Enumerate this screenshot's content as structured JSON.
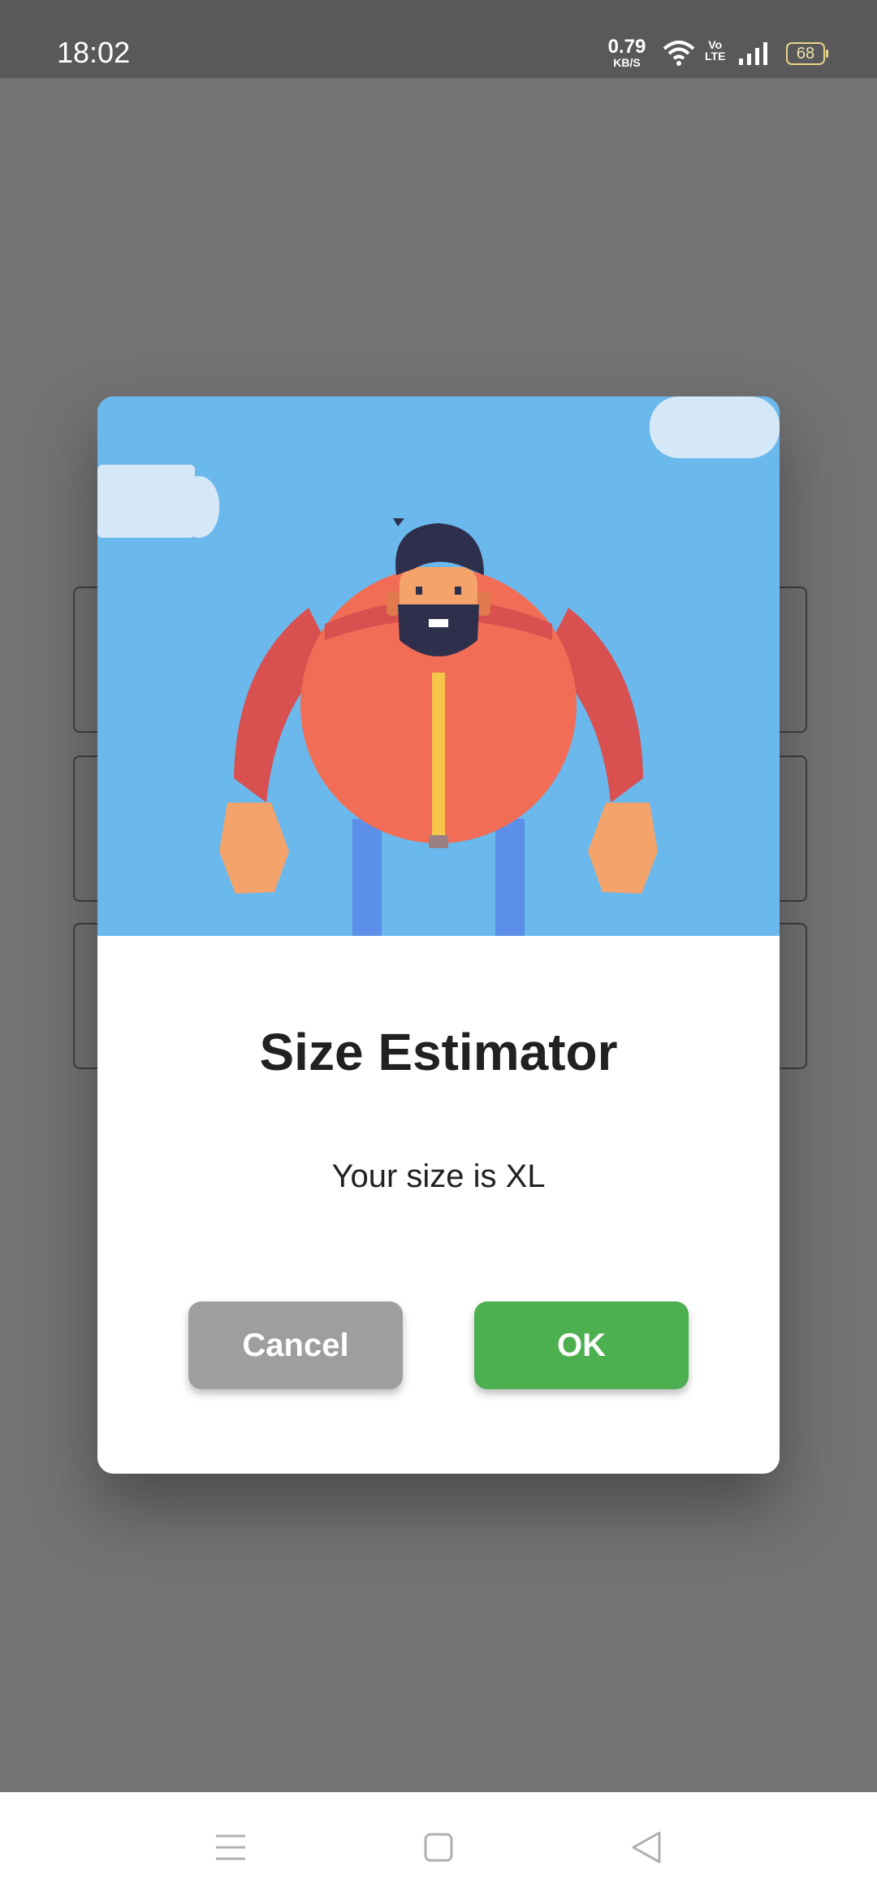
{
  "status_bar": {
    "time": "18:02",
    "net_speed_value": "0.79",
    "net_speed_unit": "KB/S",
    "volte_top": "Vo",
    "volte_bottom": "LTE",
    "battery": "68"
  },
  "dialog": {
    "title": "Size Estimator",
    "message": "Your size is XL",
    "cancel_label": "Cancel",
    "ok_label": "OK"
  },
  "nav_bar": {
    "icons": [
      "menu-icon",
      "home-square-icon",
      "back-triangle-icon"
    ]
  },
  "colors": {
    "scrim": "#737373",
    "sky": "#6bb8ec",
    "cancel": "#9e9e9e",
    "ok": "#4caf50"
  }
}
